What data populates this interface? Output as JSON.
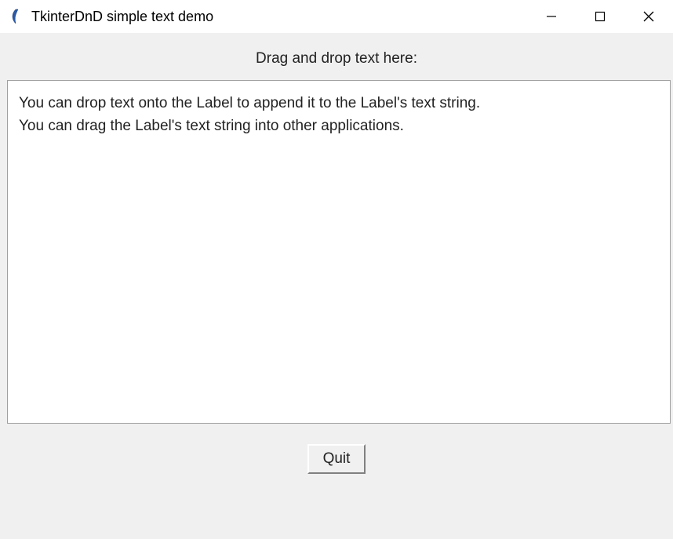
{
  "window": {
    "title": "TkinterDnD simple text demo"
  },
  "content": {
    "instruction": "Drag and drop text here:",
    "drop_text": "You can drop text onto the Label to append it to the Label's text string.\nYou can drag the Label's text string into other applications.",
    "quit_button_label": "Quit"
  }
}
